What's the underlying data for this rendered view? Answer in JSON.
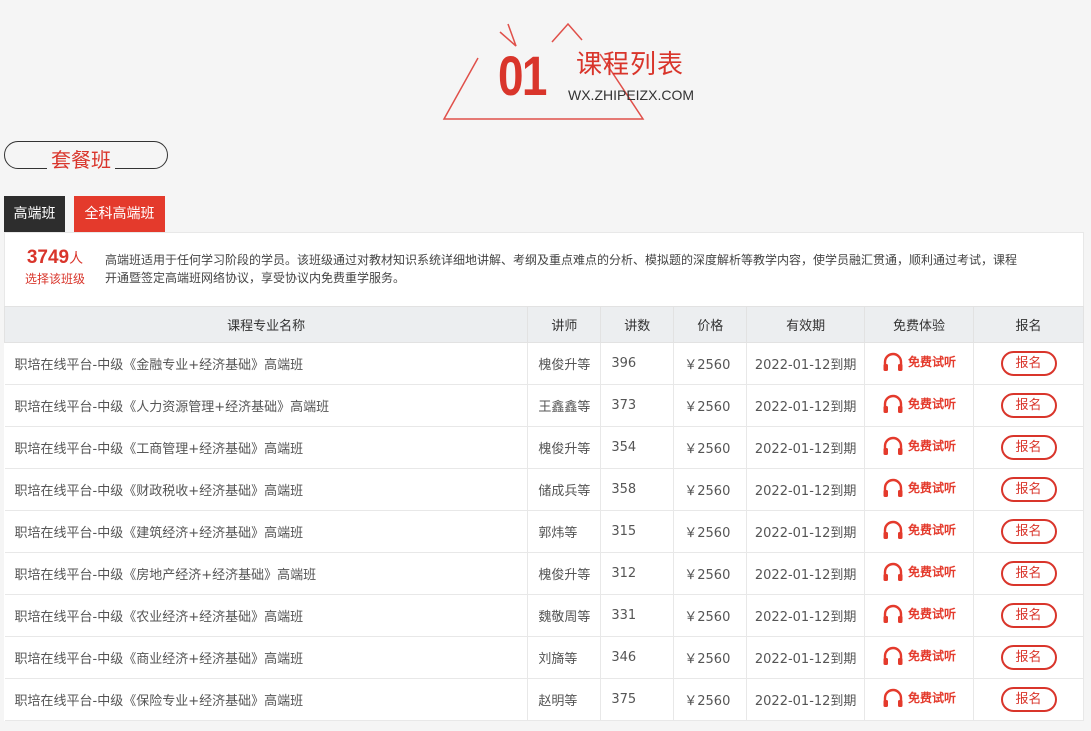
{
  "header": {
    "number": "01",
    "title": "课程列表",
    "site": "WX.ZHIPEIZX.COM"
  },
  "section": {
    "label": "套餐班"
  },
  "tabs": [
    {
      "label": "高端班"
    },
    {
      "label": "全科高端班"
    }
  ],
  "info": {
    "count": "3749",
    "count_unit": "人",
    "count_caption": "选择该班级",
    "description": "高端班适用于任何学习阶段的学员。该班级通过对教材知识系统详细地讲解、考纲及重点难点的分析、模拟题的深度解析等教学内容，使学员融汇贯通，顺利通过考试，课程开通暨签定高端班网络协议，享受协议内免费重学服务。"
  },
  "table": {
    "headers": [
      "课程专业名称",
      "讲师",
      "讲数",
      "价格",
      "有效期",
      "免费体验",
      "报名"
    ],
    "trial_label": "免费试听",
    "register_label": "报名",
    "rows": [
      {
        "name": "职培在线平台-中级《金融专业+经济基础》高端班",
        "teacher": "槐俊升等",
        "lessons": "396",
        "price": "￥2560",
        "expiry": "2022-01-12到期"
      },
      {
        "name": "职培在线平台-中级《人力资源管理+经济基础》高端班",
        "teacher": "王鑫鑫等",
        "lessons": "373",
        "price": "￥2560",
        "expiry": "2022-01-12到期"
      },
      {
        "name": "职培在线平台-中级《工商管理+经济基础》高端班",
        "teacher": "槐俊升等",
        "lessons": "354",
        "price": "￥2560",
        "expiry": "2022-01-12到期"
      },
      {
        "name": "职培在线平台-中级《财政税收+经济基础》高端班",
        "teacher": "储成兵等",
        "lessons": "358",
        "price": "￥2560",
        "expiry": "2022-01-12到期"
      },
      {
        "name": "职培在线平台-中级《建筑经济+经济基础》高端班",
        "teacher": "郭炜等",
        "lessons": "315",
        "price": "￥2560",
        "expiry": "2022-01-12到期"
      },
      {
        "name": "职培在线平台-中级《房地产经济+经济基础》高端班",
        "teacher": "槐俊升等",
        "lessons": "312",
        "price": "￥2560",
        "expiry": "2022-01-12到期"
      },
      {
        "name": "职培在线平台-中级《农业经济+经济基础》高端班",
        "teacher": "魏敬周等",
        "lessons": "331",
        "price": "￥2560",
        "expiry": "2022-01-12到期"
      },
      {
        "name": "职培在线平台-中级《商业经济+经济基础》高端班",
        "teacher": "刘旖等",
        "lessons": "346",
        "price": "￥2560",
        "expiry": "2022-01-12到期"
      },
      {
        "name": "职培在线平台-中级《保险专业+经济基础》高端班",
        "teacher": "赵明等",
        "lessons": "375",
        "price": "￥2560",
        "expiry": "2022-01-12到期"
      }
    ]
  },
  "colors": {
    "accent": "#d9352b",
    "tab_active": "#e43a2c",
    "tab_dark": "#2d2d2d"
  }
}
